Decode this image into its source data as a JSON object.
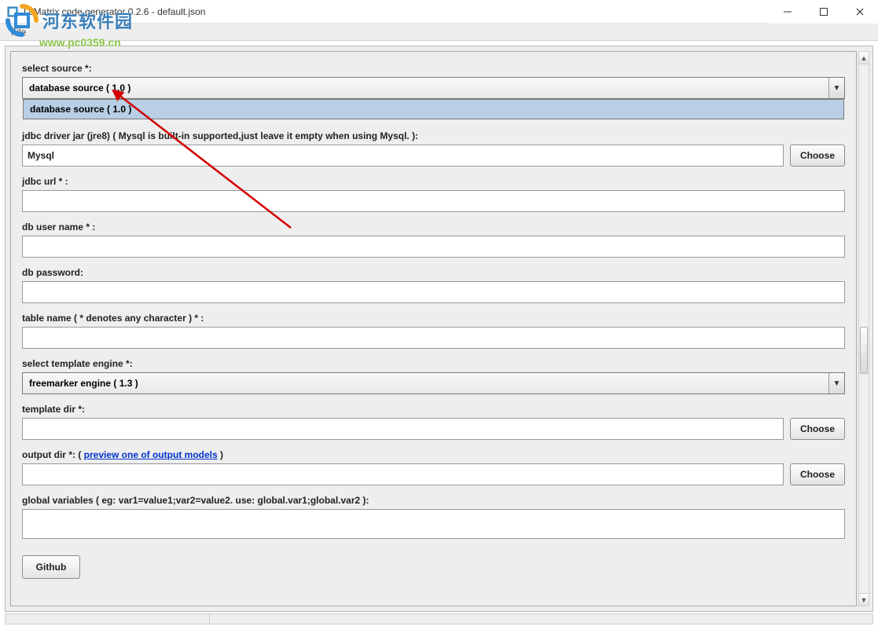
{
  "window": {
    "title": "LcMatrix code generator 0.2.6 - default.json"
  },
  "menubar": {
    "file": "File"
  },
  "watermark": {
    "text": "河东软件园",
    "url": "www.pc0359.cn"
  },
  "labels": {
    "select_source": "select source *:",
    "jdbc_driver": "jdbc driver jar (jre8) ( Mysql is built-in supported,just leave it empty when using Mysql. ):",
    "jdbc_url": "jdbc url * :",
    "db_user": "db user name * :",
    "db_password": "db password:",
    "table_name": "table name ( * denotes any character ) * :",
    "template_engine": "select template engine *:",
    "template_dir": "template dir *:",
    "output_dir": "output dir *:  ( ",
    "output_dir_link": "preview one of output models",
    "output_dir_close": " )",
    "global_vars": "global variables ( eg: var1=value1;var2=value2. use: global.var1;global.var2 ):"
  },
  "values": {
    "source_selected": "database source ( 1.0 )",
    "source_option": "database source ( 1.0 )",
    "driver_jar": "Mysql",
    "jdbc_url": "",
    "db_user": "",
    "db_password": "",
    "table_name": "",
    "template_engine": "freemarker engine ( 1.3 )",
    "template_dir": "",
    "output_dir": "",
    "global_vars": ""
  },
  "buttons": {
    "choose": "Choose",
    "github": "Github"
  }
}
